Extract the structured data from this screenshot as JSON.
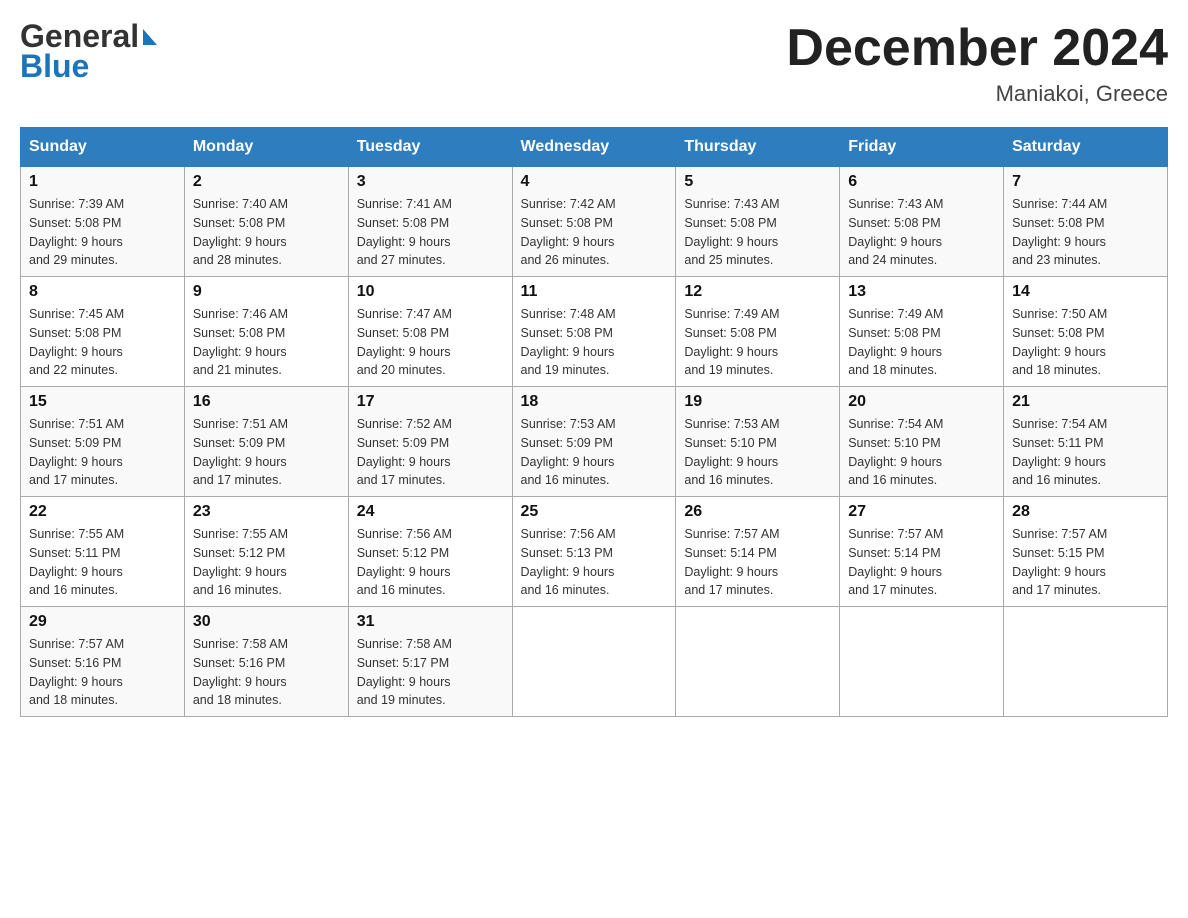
{
  "header": {
    "logo_line1": "General",
    "logo_line2": "Blue",
    "title": "December 2024",
    "subtitle": "Maniakoi, Greece"
  },
  "days_of_week": [
    "Sunday",
    "Monday",
    "Tuesday",
    "Wednesday",
    "Thursday",
    "Friday",
    "Saturday"
  ],
  "weeks": [
    [
      {
        "day": "1",
        "sunrise": "Sunrise: 7:39 AM",
        "sunset": "Sunset: 5:08 PM",
        "daylight": "Daylight: 9 hours",
        "daylight2": "and 29 minutes."
      },
      {
        "day": "2",
        "sunrise": "Sunrise: 7:40 AM",
        "sunset": "Sunset: 5:08 PM",
        "daylight": "Daylight: 9 hours",
        "daylight2": "and 28 minutes."
      },
      {
        "day": "3",
        "sunrise": "Sunrise: 7:41 AM",
        "sunset": "Sunset: 5:08 PM",
        "daylight": "Daylight: 9 hours",
        "daylight2": "and 27 minutes."
      },
      {
        "day": "4",
        "sunrise": "Sunrise: 7:42 AM",
        "sunset": "Sunset: 5:08 PM",
        "daylight": "Daylight: 9 hours",
        "daylight2": "and 26 minutes."
      },
      {
        "day": "5",
        "sunrise": "Sunrise: 7:43 AM",
        "sunset": "Sunset: 5:08 PM",
        "daylight": "Daylight: 9 hours",
        "daylight2": "and 25 minutes."
      },
      {
        "day": "6",
        "sunrise": "Sunrise: 7:43 AM",
        "sunset": "Sunset: 5:08 PM",
        "daylight": "Daylight: 9 hours",
        "daylight2": "and 24 minutes."
      },
      {
        "day": "7",
        "sunrise": "Sunrise: 7:44 AM",
        "sunset": "Sunset: 5:08 PM",
        "daylight": "Daylight: 9 hours",
        "daylight2": "and 23 minutes."
      }
    ],
    [
      {
        "day": "8",
        "sunrise": "Sunrise: 7:45 AM",
        "sunset": "Sunset: 5:08 PM",
        "daylight": "Daylight: 9 hours",
        "daylight2": "and 22 minutes."
      },
      {
        "day": "9",
        "sunrise": "Sunrise: 7:46 AM",
        "sunset": "Sunset: 5:08 PM",
        "daylight": "Daylight: 9 hours",
        "daylight2": "and 21 minutes."
      },
      {
        "day": "10",
        "sunrise": "Sunrise: 7:47 AM",
        "sunset": "Sunset: 5:08 PM",
        "daylight": "Daylight: 9 hours",
        "daylight2": "and 20 minutes."
      },
      {
        "day": "11",
        "sunrise": "Sunrise: 7:48 AM",
        "sunset": "Sunset: 5:08 PM",
        "daylight": "Daylight: 9 hours",
        "daylight2": "and 19 minutes."
      },
      {
        "day": "12",
        "sunrise": "Sunrise: 7:49 AM",
        "sunset": "Sunset: 5:08 PM",
        "daylight": "Daylight: 9 hours",
        "daylight2": "and 19 minutes."
      },
      {
        "day": "13",
        "sunrise": "Sunrise: 7:49 AM",
        "sunset": "Sunset: 5:08 PM",
        "daylight": "Daylight: 9 hours",
        "daylight2": "and 18 minutes."
      },
      {
        "day": "14",
        "sunrise": "Sunrise: 7:50 AM",
        "sunset": "Sunset: 5:08 PM",
        "daylight": "Daylight: 9 hours",
        "daylight2": "and 18 minutes."
      }
    ],
    [
      {
        "day": "15",
        "sunrise": "Sunrise: 7:51 AM",
        "sunset": "Sunset: 5:09 PM",
        "daylight": "Daylight: 9 hours",
        "daylight2": "and 17 minutes."
      },
      {
        "day": "16",
        "sunrise": "Sunrise: 7:51 AM",
        "sunset": "Sunset: 5:09 PM",
        "daylight": "Daylight: 9 hours",
        "daylight2": "and 17 minutes."
      },
      {
        "day": "17",
        "sunrise": "Sunrise: 7:52 AM",
        "sunset": "Sunset: 5:09 PM",
        "daylight": "Daylight: 9 hours",
        "daylight2": "and 17 minutes."
      },
      {
        "day": "18",
        "sunrise": "Sunrise: 7:53 AM",
        "sunset": "Sunset: 5:09 PM",
        "daylight": "Daylight: 9 hours",
        "daylight2": "and 16 minutes."
      },
      {
        "day": "19",
        "sunrise": "Sunrise: 7:53 AM",
        "sunset": "Sunset: 5:10 PM",
        "daylight": "Daylight: 9 hours",
        "daylight2": "and 16 minutes."
      },
      {
        "day": "20",
        "sunrise": "Sunrise: 7:54 AM",
        "sunset": "Sunset: 5:10 PM",
        "daylight": "Daylight: 9 hours",
        "daylight2": "and 16 minutes."
      },
      {
        "day": "21",
        "sunrise": "Sunrise: 7:54 AM",
        "sunset": "Sunset: 5:11 PM",
        "daylight": "Daylight: 9 hours",
        "daylight2": "and 16 minutes."
      }
    ],
    [
      {
        "day": "22",
        "sunrise": "Sunrise: 7:55 AM",
        "sunset": "Sunset: 5:11 PM",
        "daylight": "Daylight: 9 hours",
        "daylight2": "and 16 minutes."
      },
      {
        "day": "23",
        "sunrise": "Sunrise: 7:55 AM",
        "sunset": "Sunset: 5:12 PM",
        "daylight": "Daylight: 9 hours",
        "daylight2": "and 16 minutes."
      },
      {
        "day": "24",
        "sunrise": "Sunrise: 7:56 AM",
        "sunset": "Sunset: 5:12 PM",
        "daylight": "Daylight: 9 hours",
        "daylight2": "and 16 minutes."
      },
      {
        "day": "25",
        "sunrise": "Sunrise: 7:56 AM",
        "sunset": "Sunset: 5:13 PM",
        "daylight": "Daylight: 9 hours",
        "daylight2": "and 16 minutes."
      },
      {
        "day": "26",
        "sunrise": "Sunrise: 7:57 AM",
        "sunset": "Sunset: 5:14 PM",
        "daylight": "Daylight: 9 hours",
        "daylight2": "and 17 minutes."
      },
      {
        "day": "27",
        "sunrise": "Sunrise: 7:57 AM",
        "sunset": "Sunset: 5:14 PM",
        "daylight": "Daylight: 9 hours",
        "daylight2": "and 17 minutes."
      },
      {
        "day": "28",
        "sunrise": "Sunrise: 7:57 AM",
        "sunset": "Sunset: 5:15 PM",
        "daylight": "Daylight: 9 hours",
        "daylight2": "and 17 minutes."
      }
    ],
    [
      {
        "day": "29",
        "sunrise": "Sunrise: 7:57 AM",
        "sunset": "Sunset: 5:16 PM",
        "daylight": "Daylight: 9 hours",
        "daylight2": "and 18 minutes."
      },
      {
        "day": "30",
        "sunrise": "Sunrise: 7:58 AM",
        "sunset": "Sunset: 5:16 PM",
        "daylight": "Daylight: 9 hours",
        "daylight2": "and 18 minutes."
      },
      {
        "day": "31",
        "sunrise": "Sunrise: 7:58 AM",
        "sunset": "Sunset: 5:17 PM",
        "daylight": "Daylight: 9 hours",
        "daylight2": "and 19 minutes."
      },
      null,
      null,
      null,
      null
    ]
  ]
}
